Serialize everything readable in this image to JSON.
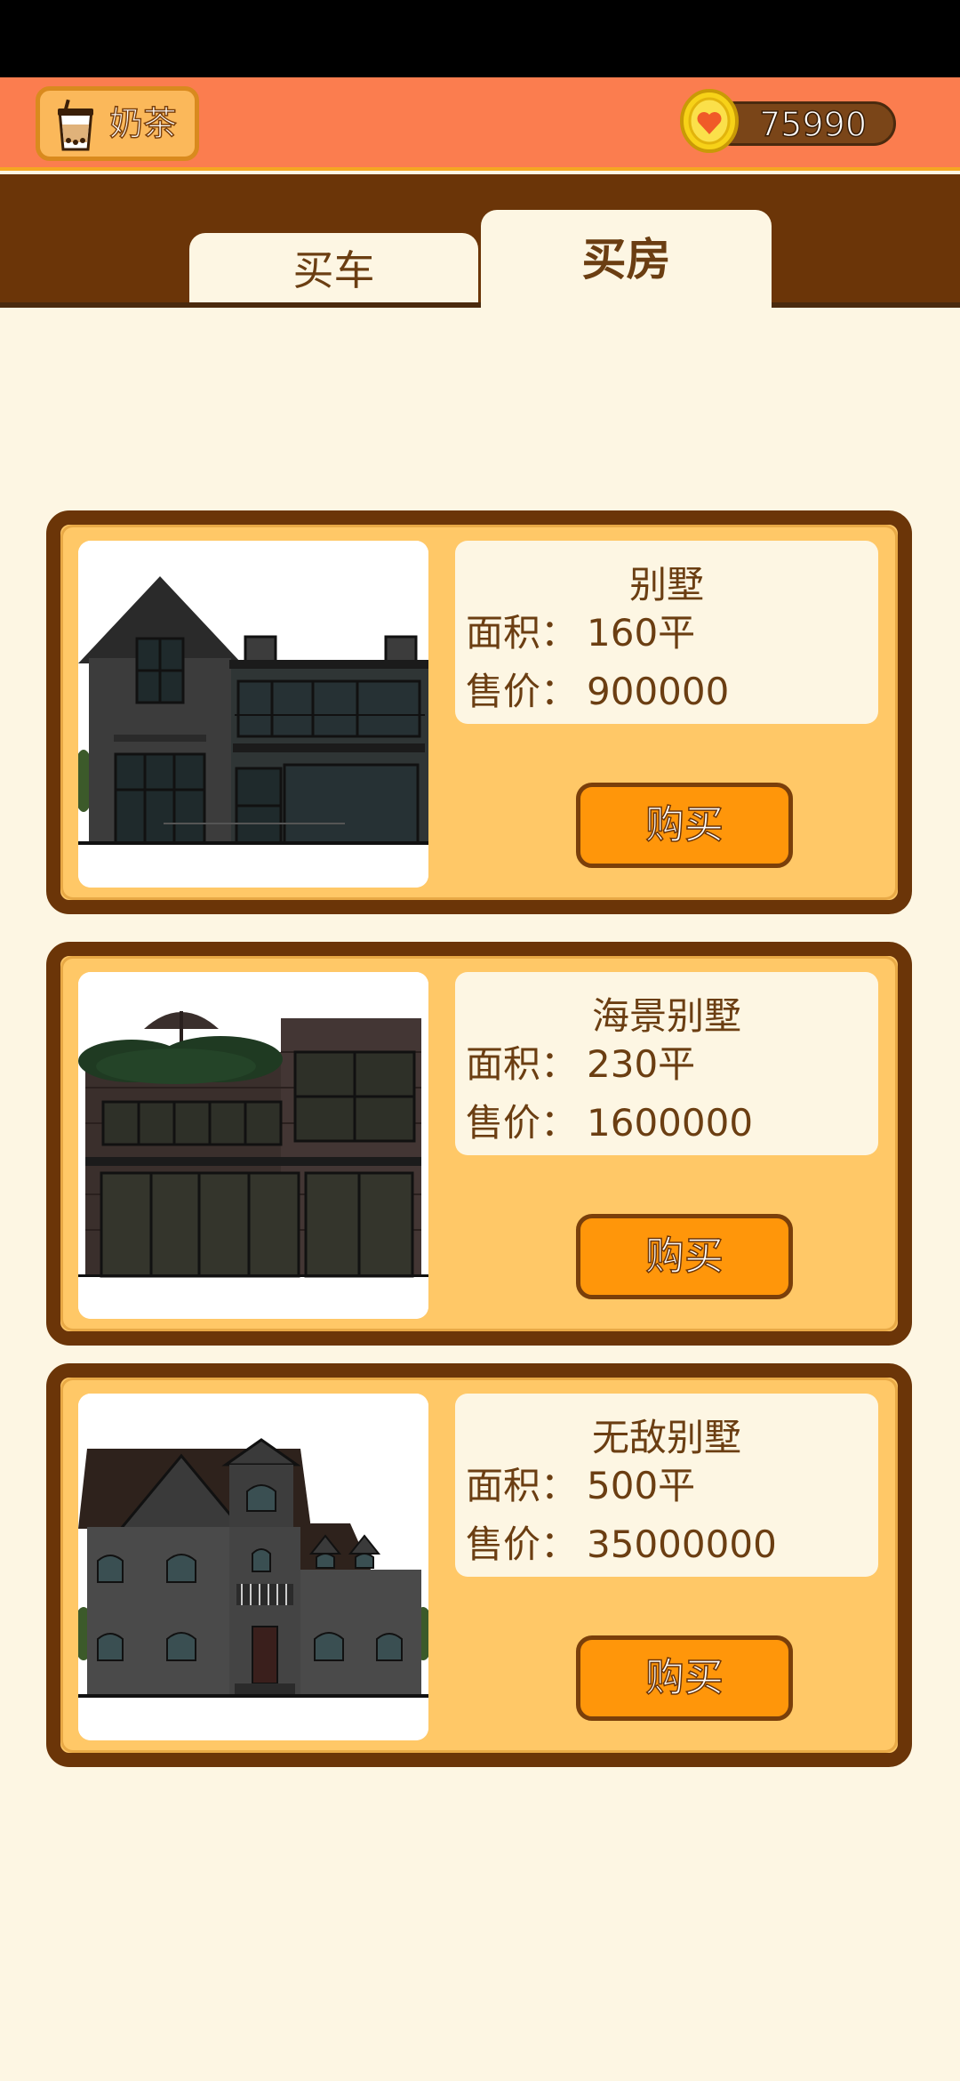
{
  "header": {
    "milktea_label": "奶茶",
    "coins": "75990",
    "milktea_icon": "milk-tea-cup-icon",
    "coin_icon": "gold-coin-heart-icon"
  },
  "tabs": [
    {
      "label": "买车",
      "active": false
    },
    {
      "label": "买房",
      "active": true
    }
  ],
  "labels": {
    "area": "面积：",
    "price": "售价："
  },
  "houses": [
    {
      "name": "别墅",
      "area": "160平",
      "price": "900000",
      "buy_label": "购买",
      "image": "modern-villa-image"
    },
    {
      "name": "海景别墅",
      "area": "230平",
      "price": "1600000",
      "buy_label": "购买",
      "image": "seaview-villa-image"
    },
    {
      "name": "无敌别墅",
      "area": "500平",
      "price": "35000000",
      "buy_label": "购买",
      "image": "grand-villa-image"
    }
  ],
  "colors": {
    "header_bg": "#fb7d4f",
    "tab_band": "#6b3508",
    "card_bg": "#ffc867",
    "buy_button": "#ff960a",
    "page_bg": "#fdf6e3"
  }
}
